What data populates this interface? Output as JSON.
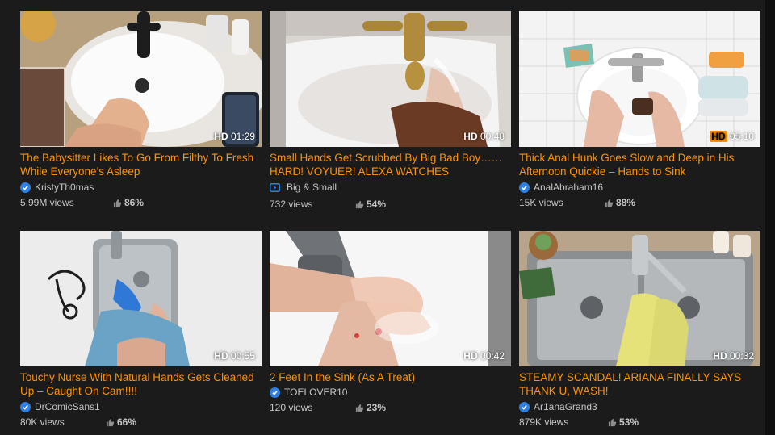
{
  "videos": [
    {
      "title": "The Babysitter Likes To Go From Filthy To Fresh While Everyone’s Asleep",
      "uploader": "KristyTh0mas",
      "uploader_type": "verified",
      "views": "5.99M views",
      "rating": "86%",
      "hd": "HD",
      "duration": "01:29"
    },
    {
      "title": "Small Hands Get Scrubbed By Big Bad Boy……HARD! VOYUER! ALEXA WATCHES",
      "uploader": "Big & Small",
      "uploader_type": "channel",
      "views": "732 views",
      "rating": "54%",
      "hd": "HD",
      "duration": "00:48"
    },
    {
      "title": "Thick Anal Hunk Goes Slow and Deep in His Afternoon Quickie – Hands to Sink",
      "uploader": "AnalAbraham16",
      "uploader_type": "verified",
      "views": "15K views",
      "rating": "88%",
      "hd": "HD",
      "duration": "05:10"
    },
    {
      "title": "Touchy Nurse With Natural Hands Gets Cleaned Up – Caught On Cam!!!!",
      "uploader": "DrComicSans1",
      "uploader_type": "verified",
      "views": "80K views",
      "rating": "66%",
      "hd": "HD",
      "duration": "00:55"
    },
    {
      "title": "2 Feet In the Sink (As A Treat)",
      "uploader": "TOELOVER10",
      "uploader_type": "verified",
      "views": "120 views",
      "rating": "23%",
      "hd": "HD",
      "duration": "00:42"
    },
    {
      "title": "STEAMY SCANDAL! ARIANA FINALLY SAYS THANK U, WASH!",
      "uploader": "Ar1anaGrand3",
      "uploader_type": "verified",
      "views": "879K views",
      "rating": "53%",
      "hd": "HD",
      "duration": "00:32"
    }
  ],
  "colors": {
    "accent": "#ff9000",
    "background": "#1b1b1b",
    "verified": "#2f7fe0",
    "text_secondary": "#c6c6c6"
  },
  "icons": {
    "verified": "check-badge-icon",
    "channel": "play-channel-icon",
    "rating": "thumbs-up-icon"
  }
}
